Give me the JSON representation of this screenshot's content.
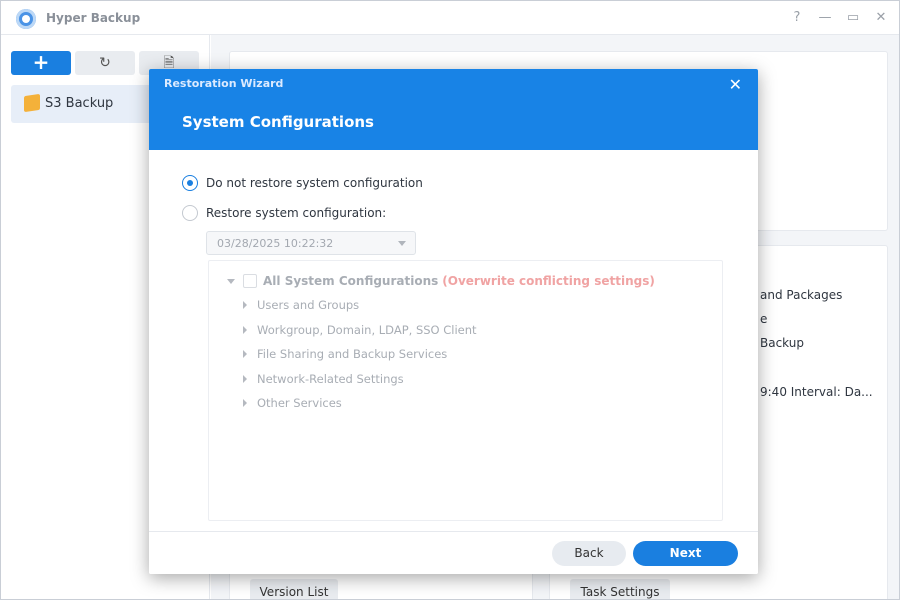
{
  "app": {
    "title": "Hyper Backup",
    "controls": {
      "help": "?",
      "minimize": "—",
      "maximize": "▭",
      "close": "✕"
    }
  },
  "sidebar": {
    "toolbar": {
      "add": "+",
      "history": "↻",
      "log": "🗎"
    },
    "tasks": [
      {
        "label": "S3 Backup"
      }
    ]
  },
  "background": {
    "lines": [
      "and Packages",
      "e",
      "Backup",
      "9:40 Interval: Da..."
    ],
    "version_list_label": "Version List",
    "task_settings_label": "Task Settings"
  },
  "modal": {
    "wizard_label": "Restoration Wizard",
    "close": "✕",
    "title": "System Configurations",
    "options": [
      {
        "label": "Do not restore system configuration",
        "checked": true
      },
      {
        "label": "Restore system configuration:",
        "checked": false
      }
    ],
    "version_dropdown": {
      "value": "03/28/2025 10:22:32"
    },
    "tree": {
      "root_label": "All System Configurations",
      "root_warning": "(Overwrite conflicting settings)",
      "children": [
        "Users and Groups",
        "Workgroup, Domain, LDAP, SSO Client",
        "File Sharing and Backup Services",
        "Network-Related Settings",
        "Other Services"
      ]
    },
    "footer": {
      "back_label": "Back",
      "next_label": "Next"
    }
  },
  "colors": {
    "accent": "#1883e6",
    "warning": "#f0a3a3"
  }
}
